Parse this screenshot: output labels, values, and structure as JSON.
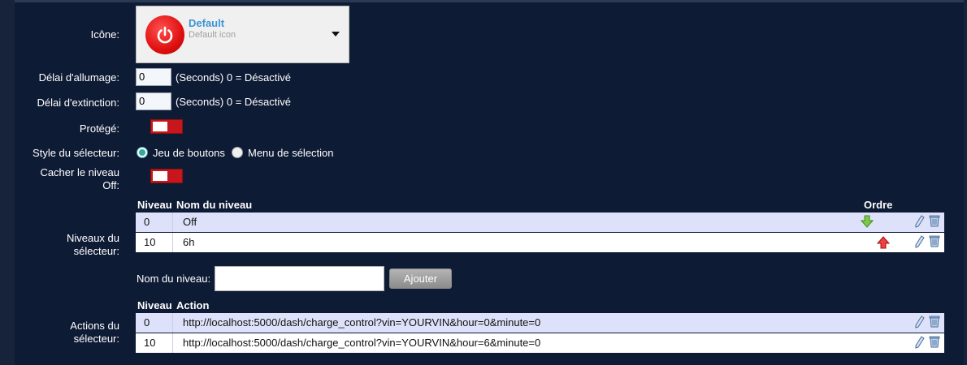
{
  "form": {
    "icon_label": "Icône:",
    "icon_title": "Default",
    "icon_desc": "Default icon",
    "on_delay_label": "Délai d'allumage:",
    "on_delay_value": "0",
    "on_delay_hint": "(Seconds) 0 = Désactivé",
    "off_delay_label": "Délai d'extinction:",
    "off_delay_value": "0",
    "off_delay_hint": "(Seconds) 0 = Désactivé",
    "protected_label": "Protégé:",
    "selector_style_label": "Style du sélecteur:",
    "style_option_buttons": "Jeu de boutons",
    "style_option_menu": "Menu de sélection",
    "hide_off_label_1": "Cacher le niveau",
    "hide_off_label_2": "Off:"
  },
  "levels": {
    "label_1": "Niveaux du",
    "label_2": "sélecteur:",
    "col_level": "Niveau",
    "col_name": "Nom du niveau",
    "col_order": "Ordre",
    "rows": [
      {
        "level": "0",
        "name": "Off"
      },
      {
        "level": "10",
        "name": "6h"
      }
    ]
  },
  "add_level": {
    "label": "Nom du niveau:",
    "value": "",
    "button": "Ajouter"
  },
  "actions": {
    "label_1": "Actions du",
    "label_2": "sélecteur:",
    "col_level": "Niveau",
    "col_action": "Action",
    "rows": [
      {
        "level": "0",
        "action": "http://localhost:5000/dash/charge_control?vin=YOURVIN&hour=0&minute=0"
      },
      {
        "level": "10",
        "action": "http://localhost:5000/dash/charge_control?vin=YOURVIN&hour=6&minute=0"
      }
    ]
  },
  "icons": {
    "power": "power-icon",
    "down": "arrow-down-icon",
    "up": "arrow-up-icon",
    "edit": "pencil-icon",
    "delete": "trash-icon"
  },
  "colors": {
    "background": "#0e1b35",
    "toggle_off": "#c8161d",
    "link_blue": "#3a96d4",
    "row_alt": "#dde2fa"
  }
}
